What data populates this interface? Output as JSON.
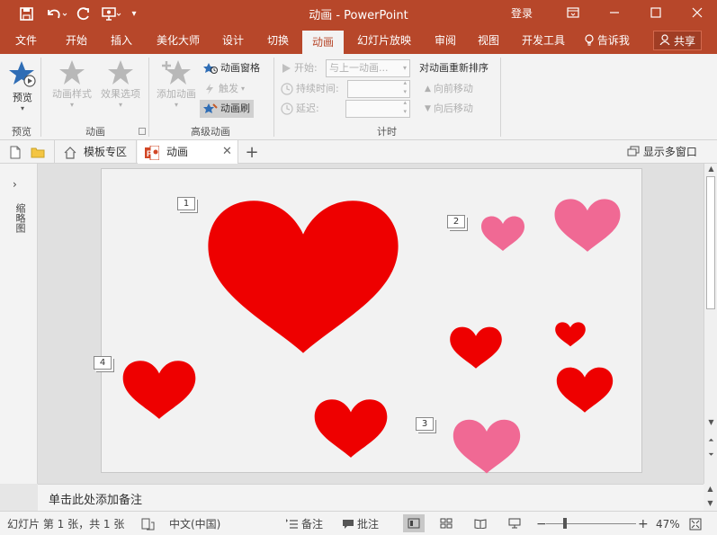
{
  "app": {
    "title": "动画 - PowerPoint",
    "sign_in": "登录"
  },
  "menu": {
    "tabs": [
      "文件",
      "开始",
      "插入",
      "美化大师",
      "设计",
      "切换",
      "动画",
      "幻灯片放映",
      "审阅",
      "视图",
      "开发工具"
    ],
    "active_tab": "动画",
    "tell_me": "告诉我",
    "share": "共享"
  },
  "ribbon": {
    "preview": "预览",
    "anim_styles": "动画样式",
    "effect_options": "效果选项",
    "add_animation": "添加动画",
    "animation_pane": "动画窗格",
    "trigger": "触发",
    "animation_painter": "动画刷",
    "start_label": "开始:",
    "start_value": "与上一动画...",
    "duration_label": "持续时间:",
    "delay_label": "延迟:",
    "reorder_title": "对动画重新排序",
    "move_earlier": "向前移动",
    "move_later": "向后移动",
    "groups": {
      "preview": "预览",
      "animation": "动画",
      "advanced": "高级动画",
      "timing": "计时"
    }
  },
  "doc_tabs": {
    "templates": "模板专区",
    "current": "动画",
    "multi_window": "显示多窗口"
  },
  "left_pane": {
    "label": "缩略图"
  },
  "slide": {
    "animation_tags": [
      "1",
      "2",
      "3",
      "4"
    ]
  },
  "notes": {
    "placeholder": "单击此处添加备注"
  },
  "status": {
    "slide_info": "幻灯片 第 1 张，共 1 张",
    "language": "中文(中国)",
    "notes": "备注",
    "comments": "批注",
    "zoom": "47%"
  },
  "colors": {
    "brand": "#b7472a",
    "heart_red": "#ee0000",
    "heart_pink": "#f06994"
  }
}
